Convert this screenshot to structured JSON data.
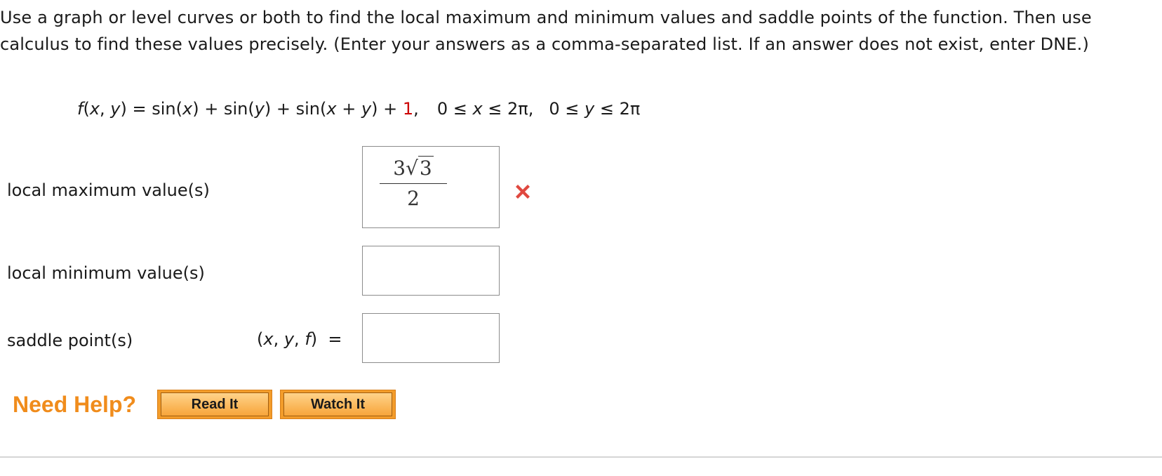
{
  "question": {
    "prompt": "Use a graph or level curves or both to find the local maximum and minimum values and saddle points of the function. Then use calculus to find these values precisely. (Enter your answers as a comma-separated list. If an answer does not exist, enter DNE.)",
    "formula": {
      "f": "f",
      "args_open": "(",
      "x": "x",
      "comma": ", ",
      "y": "y",
      "args_close": ")",
      "eq": " = sin(",
      "x2": "x",
      "p1": ") + sin(",
      "y2": "y",
      "p2": ") + sin(",
      "x3": "x",
      "plus": " + ",
      "y3": "y",
      "p3": ") + ",
      "const": "1",
      "trail": ",",
      "domain_x_a": "0 ≤ ",
      "domain_x_var": "x",
      "domain_x_b": " ≤ 2π,",
      "domain_y_a": "0 ≤ ",
      "domain_y_var": "y",
      "domain_y_b": " ≤ 2π"
    }
  },
  "answers": {
    "local_max": {
      "label": "local maximum value(s)",
      "numerator_coef": "3",
      "numerator_radicand": "3",
      "radical_sign": "√",
      "denominator": "2",
      "status": "incorrect",
      "status_icon": "x-mark-icon",
      "status_color": "#e0483f"
    },
    "local_min": {
      "label": "local minimum value(s)",
      "value": ""
    },
    "saddle": {
      "label": "saddle point(s)",
      "tuple_open": "(",
      "tuple_x": "x",
      "tuple_c1": ", ",
      "tuple_y": "y",
      "tuple_c2": ", ",
      "tuple_f": "f",
      "tuple_close": ")",
      "tuple_eq": "  =",
      "value": ""
    }
  },
  "help": {
    "title": "Need Help?",
    "read_it": "Read It",
    "watch_it": "Watch It",
    "accent_color": "#f08c1c"
  }
}
